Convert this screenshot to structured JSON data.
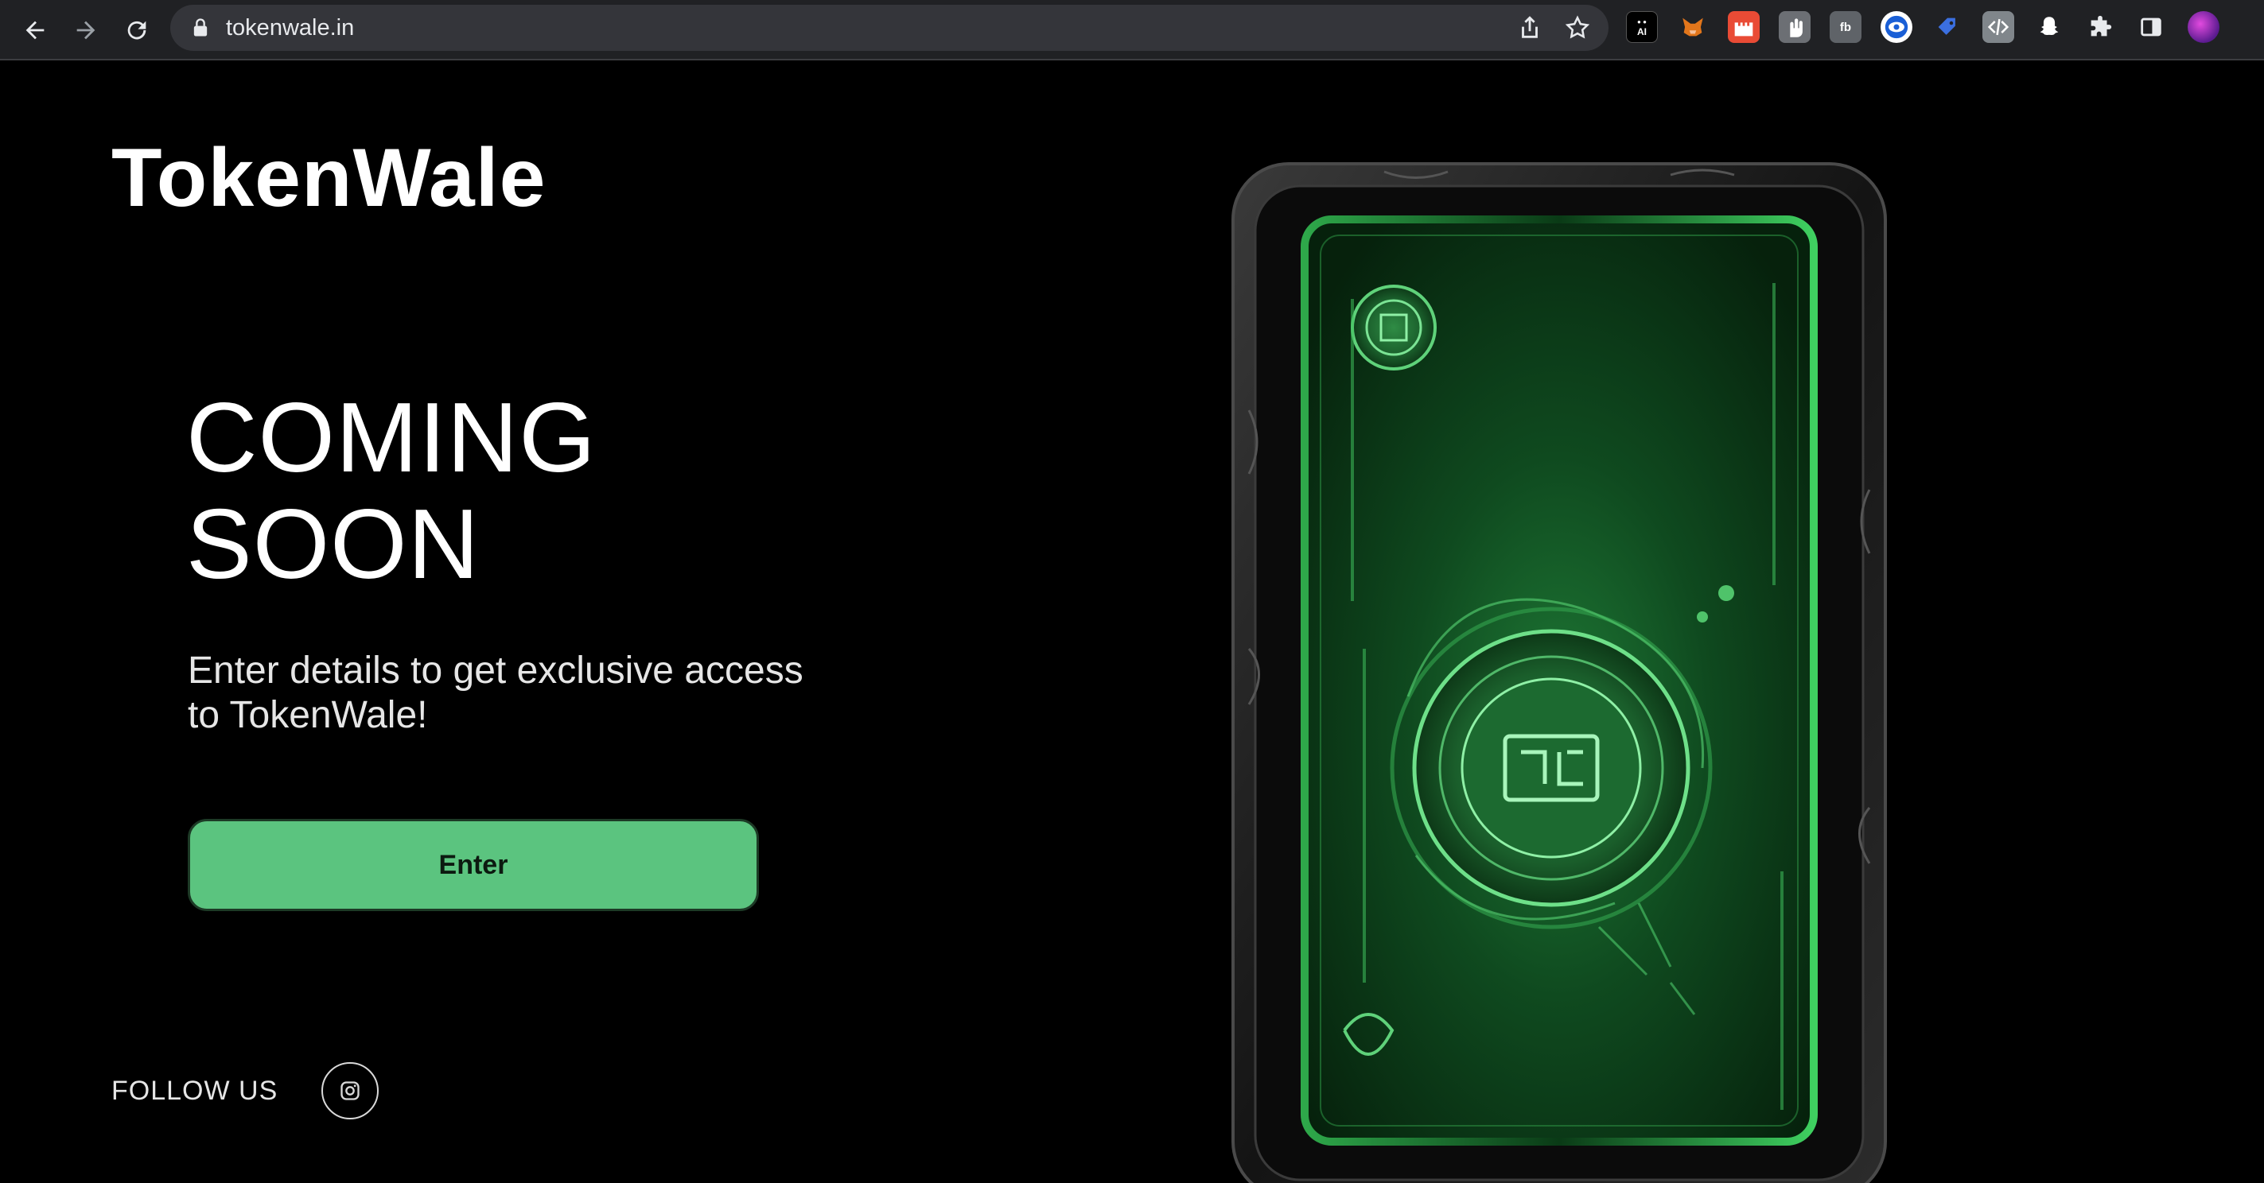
{
  "browser": {
    "url": "tokenwale.in",
    "extensions": [
      "ai-tool-extension",
      "metamask-fox-extension",
      "castle-extension",
      "hand-extension",
      "fb-extension",
      "eye-extension",
      "tag-extension",
      "code-extension",
      "snapchat-extension",
      "puzzle-extensions-icon",
      "side-panel-icon",
      "profile-avatar"
    ],
    "extension_texts": {
      "ai": "AI",
      "fb": "fb"
    }
  },
  "site": {
    "logo": "TokenWale",
    "headline_line1": "COMING",
    "headline_line2": "SOON",
    "subtext": "Enter details to get exclusive access to TokenWale!",
    "enter_button": "Enter",
    "follow_us": "FOLLOW US"
  },
  "colors": {
    "accent_green": "#5bc47f",
    "background": "#000000",
    "chrome": "#202124"
  }
}
